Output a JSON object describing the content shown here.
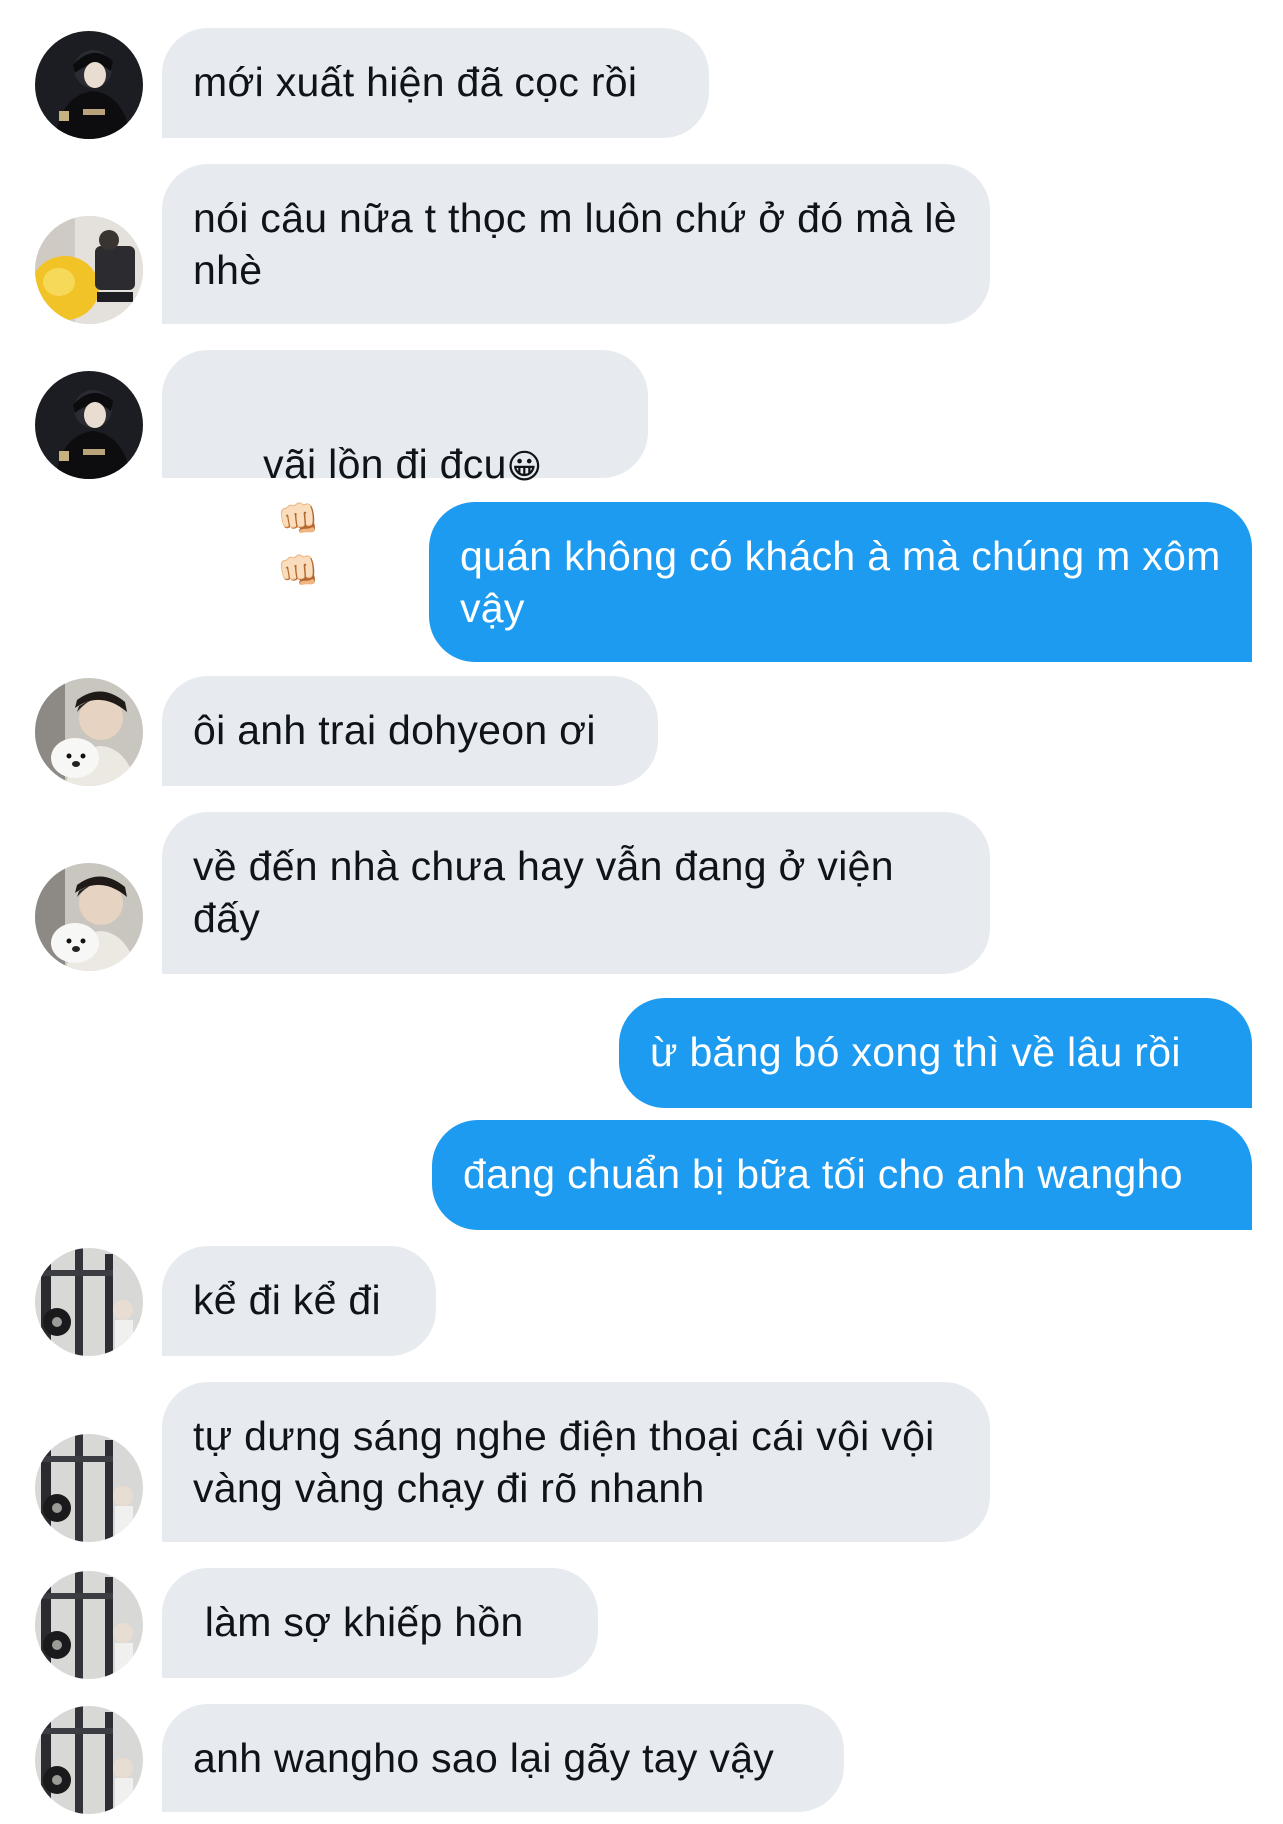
{
  "conversation": {
    "messages": [
      {
        "from": "them",
        "avatar": "avatar-a",
        "text": "mới xuất hiện đã cọc rồi"
      },
      {
        "from": "them",
        "avatar": "avatar-b",
        "text": "nói câu nữa t thọc m luôn chứ ở đó mà lè nhè"
      },
      {
        "from": "them",
        "avatar": "avatar-a",
        "text": "vãi lồn đi đcu",
        "emojis": [
          "😀",
          "👊🏻",
          "👊🏻"
        ]
      },
      {
        "from": "me",
        "text": "quán không có khách à mà chúng m xôm vậy"
      },
      {
        "from": "them",
        "avatar": "avatar-c",
        "text": "ôi anh trai dohyeon ơi"
      },
      {
        "from": "them",
        "avatar": "avatar-c",
        "text": "về đến nhà chưa hay vẫn đang ở viện đấy"
      },
      {
        "from": "me",
        "text": "ừ băng bó xong thì về lâu rồi"
      },
      {
        "from": "me",
        "text": "đang chuẩn bị bữa tối cho anh wangho"
      },
      {
        "from": "them",
        "avatar": "avatar-d",
        "text": "kể đi kể đi"
      },
      {
        "from": "them",
        "avatar": "avatar-d",
        "text": "tự dưng sáng nghe điện thoại cái vội vội vàng vàng chạy đi rõ nhanh"
      },
      {
        "from": "them",
        "avatar": "avatar-d",
        "text": " làm sợ khiếp hồn"
      },
      {
        "from": "them",
        "avatar": "avatar-d",
        "text": "anh wangho sao lại gãy tay vậy"
      }
    ]
  },
  "colors": {
    "incoming_bubble": "#e7ebef",
    "outgoing_bubble": "#1d9bf0",
    "incoming_text": "#0f1419",
    "outgoing_text": "#ffffff"
  }
}
